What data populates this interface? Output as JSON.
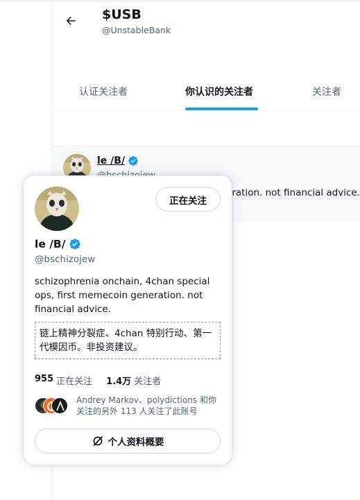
{
  "header": {
    "title": "$USB",
    "handle": "@UnstableBank"
  },
  "tabs": [
    {
      "label": "认证关注者",
      "active": false
    },
    {
      "label": "你认识的关注者",
      "active": true
    },
    {
      "label": "关注者",
      "active": false
    }
  ],
  "background_row": {
    "name": "le /B/",
    "handle": "@bschizojew",
    "bio_visible": "schizophrenia onchain, 4chan special ops, first memecoin generation. not financial advice."
  },
  "hover_card": {
    "follow_button": "正在关注",
    "name": "le /B/",
    "handle": "@bschizojew",
    "bio": "schizophrenia onchain, 4chan special ops, first memecoin generation. not financial advice.",
    "translation": "链上精神分裂症、4chan 特别行动、第一代模因币。非投资建议。",
    "following_count": "955",
    "following_label": "正在关注",
    "followers_count": "1.4万",
    "followers_label": "关注者",
    "mutuals_text": "Andrey Markov、polydictions 和你关注的另外 113 人关注了此账号",
    "profile_summary_button": "个人资料概要"
  },
  "colors": {
    "accent": "#1d9bf0",
    "text": "#0f1419",
    "secondary": "#536471",
    "verified": "#1d9bf0"
  },
  "icons": [
    "back-arrow-icon",
    "verified-badge-icon",
    "grok-slash-icon"
  ]
}
